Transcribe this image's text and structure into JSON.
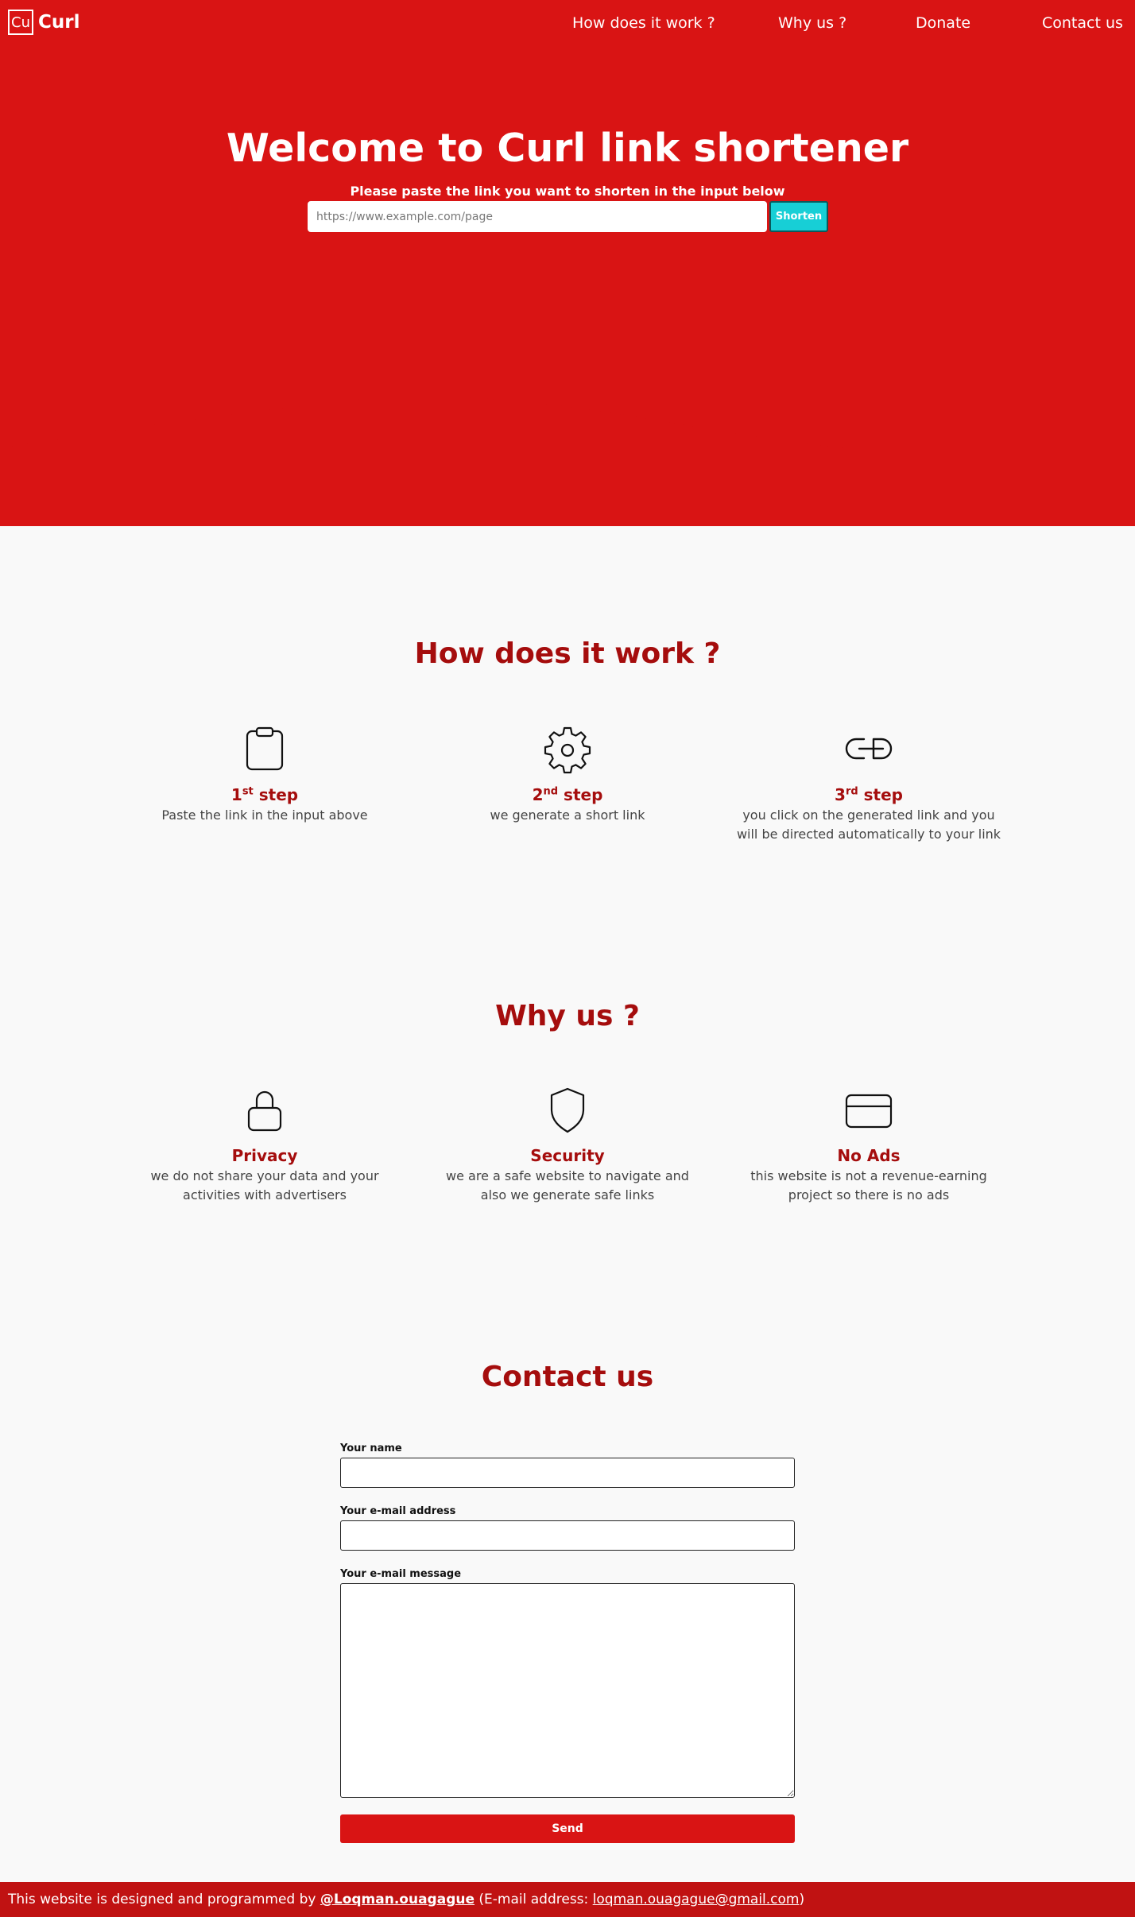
{
  "colors": {
    "brand_red": "#d91414",
    "title_red": "#a50d0d",
    "accent_cyan": "#17cfd6",
    "background": "#f9f9f9"
  },
  "nav": {
    "logo_box": "Cu",
    "logo_text": "Curl",
    "links": [
      "How does it work ?",
      "Why us ?",
      "Donate",
      "Contact us"
    ]
  },
  "hero": {
    "title": "Welcome to Curl link shortener",
    "subtitle": "Please paste the link you want to shorten in the input below",
    "input_placeholder": "https://www.example.com/page",
    "button_label": "Shorten"
  },
  "how": {
    "title": "How does it work ?",
    "steps": [
      {
        "icon": "clipboard-icon",
        "num": "1",
        "sup": "st",
        "word": "step",
        "desc": "Paste the link in the input above"
      },
      {
        "icon": "gear-icon",
        "num": "2",
        "sup": "nd",
        "word": "step",
        "desc": "we generate a short link"
      },
      {
        "icon": "link-icon",
        "num": "3",
        "sup": "rd",
        "word": "step",
        "desc": "you click on the generated link and you will be directed automatically to your link"
      }
    ]
  },
  "why": {
    "title": "Why us ?",
    "items": [
      {
        "icon": "lock-icon",
        "title": "Privacy",
        "desc": "we do not share your data and your activities with advertisers"
      },
      {
        "icon": "shield-icon",
        "title": "Security",
        "desc": "we are a safe website to navigate and also we generate safe links"
      },
      {
        "icon": "card-icon",
        "title": "No Ads",
        "desc": "this website is not a revenue-earning project so there is no ads"
      }
    ]
  },
  "contact": {
    "title": "Contact us",
    "name_label": "Your name",
    "name_value": "",
    "email_label": "Your e-mail address",
    "email_value": "",
    "message_label": "Your e-mail message",
    "message_value": "",
    "send_label": "Send"
  },
  "footer": {
    "prefix": "This website is designed and programmed by",
    "author": "@Loqman.ouagague",
    "email_open": "(E-mail address:",
    "email": "loqman.ouagague@gmail.com",
    "email_close": ")"
  }
}
